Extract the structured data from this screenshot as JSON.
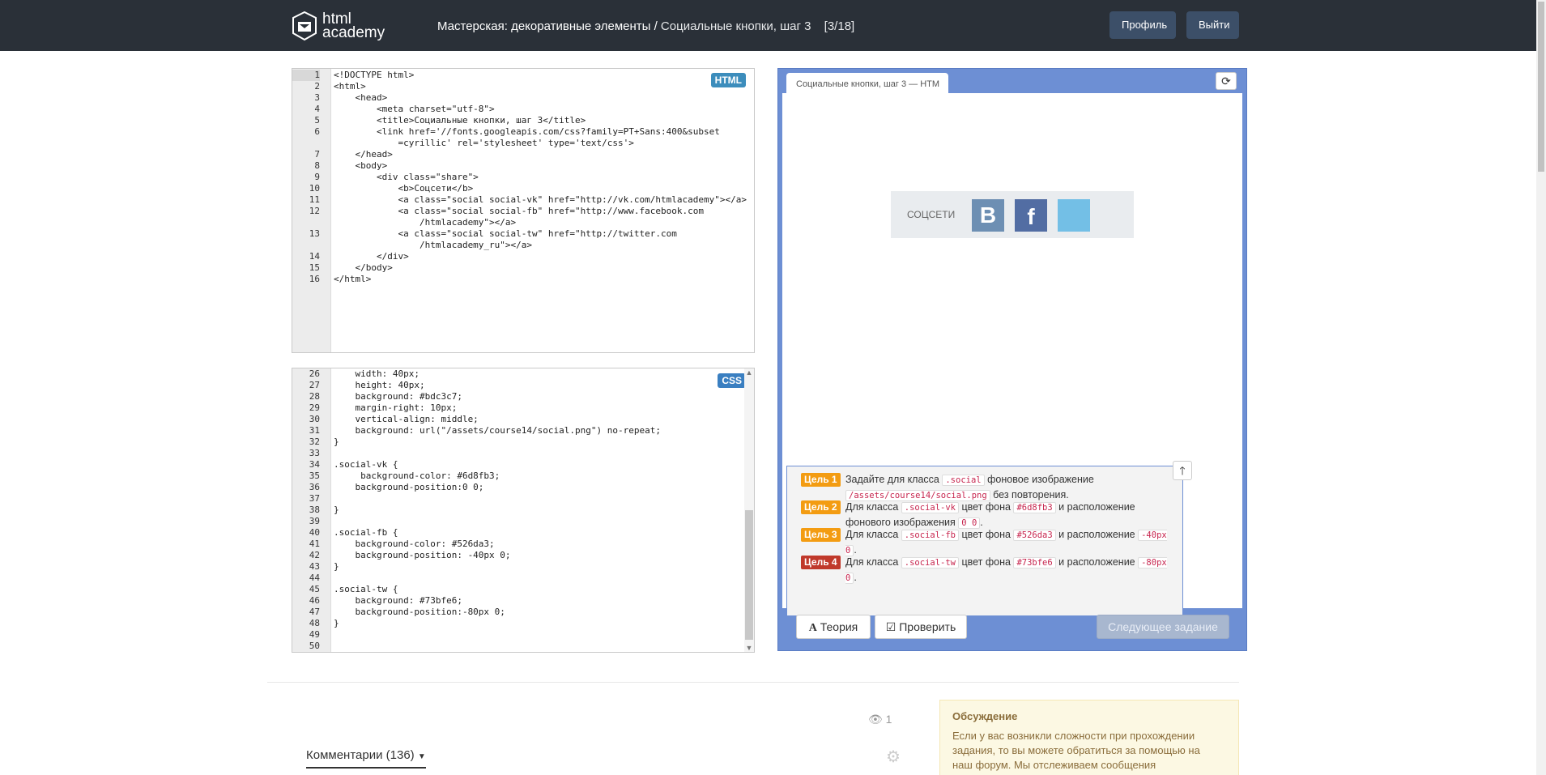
{
  "header": {
    "logo_line1": "html",
    "logo_line2": "academy",
    "crumb_bold": "Мастерская: декоративные элементы /",
    "crumb_light": "Социальные кнопки, шаг 3",
    "crumb_counter": "[3/18]",
    "profile_label": "Профиль",
    "logout_label": "Выйти"
  },
  "html_editor": {
    "badge": "HTML",
    "lines": [
      {
        "n": "1",
        "t": "<!DOCTYPE html>"
      },
      {
        "n": "2",
        "t": "<html>"
      },
      {
        "n": "3",
        "t": "    <head>"
      },
      {
        "n": "4",
        "t": "        <meta charset=\"utf-8\">"
      },
      {
        "n": "5",
        "t": "        <title>Социальные кнопки, шаг 3</title>"
      },
      {
        "n": "6",
        "t": "        <link href='//fonts.googleapis.com/css?family=PT+Sans:400&subset"
      },
      {
        "n": "",
        "t": "            =cyrillic' rel='stylesheet' type='text/css'>"
      },
      {
        "n": "7",
        "t": "    </head>"
      },
      {
        "n": "8",
        "t": "    <body>"
      },
      {
        "n": "9",
        "t": "        <div class=\"share\">"
      },
      {
        "n": "10",
        "t": "            <b>Соцсети</b>"
      },
      {
        "n": "11",
        "t": "            <a class=\"social social-vk\" href=\"http://vk.com/htmlacademy\"></a>"
      },
      {
        "n": "12",
        "t": "            <a class=\"social social-fb\" href=\"http://www.facebook.com"
      },
      {
        "n": "",
        "t": "                /htmlacademy\"></a>"
      },
      {
        "n": "13",
        "t": "            <a class=\"social social-tw\" href=\"http://twitter.com"
      },
      {
        "n": "",
        "t": "                /htmlacademy_ru\"></a>"
      },
      {
        "n": "14",
        "t": "        </div>"
      },
      {
        "n": "15",
        "t": "    </body>"
      },
      {
        "n": "16",
        "t": "</html>"
      }
    ]
  },
  "css_editor": {
    "badge": "CSS",
    "lines": [
      {
        "n": "26",
        "t": "    width: 40px;"
      },
      {
        "n": "27",
        "t": "    height: 40px;"
      },
      {
        "n": "28",
        "t": "    background: #bdc3c7;"
      },
      {
        "n": "29",
        "t": "    margin-right: 10px;"
      },
      {
        "n": "30",
        "t": "    vertical-align: middle;"
      },
      {
        "n": "31",
        "t": "    background: url(\"/assets/course14/social.png\") no-repeat;"
      },
      {
        "n": "32",
        "t": "}"
      },
      {
        "n": "33",
        "t": ""
      },
      {
        "n": "34",
        "t": ".social-vk {"
      },
      {
        "n": "35",
        "t": "     background-color: #6d8fb3;"
      },
      {
        "n": "36",
        "t": "    background-position:0 0;"
      },
      {
        "n": "37",
        "t": ""
      },
      {
        "n": "38",
        "t": "}"
      },
      {
        "n": "39",
        "t": ""
      },
      {
        "n": "40",
        "t": ".social-fb {"
      },
      {
        "n": "41",
        "t": "    background-color: #526da3;"
      },
      {
        "n": "42",
        "t": "    background-position: -40px 0;"
      },
      {
        "n": "43",
        "t": "}"
      },
      {
        "n": "44",
        "t": ""
      },
      {
        "n": "45",
        "t": ".social-tw {"
      },
      {
        "n": "46",
        "t": "    background: #73bfe6;"
      },
      {
        "n": "47",
        "t": "    background-position:-80px 0;"
      },
      {
        "n": "48",
        "t": "}"
      },
      {
        "n": "49",
        "t": ""
      },
      {
        "n": "50",
        "t": ""
      }
    ]
  },
  "preview": {
    "tab_title": "Социальные кнопки, шаг 3 — HTM",
    "share_label": "СОЦСЕТИ",
    "vk_letter": "B",
    "fb_letter": "f",
    "colors": {
      "vk": "#6d8fb3",
      "fb": "#526da3",
      "tw": "#73bfe6"
    }
  },
  "goals": [
    {
      "tag": "Цель 1",
      "color": "orange",
      "parts": [
        "Задайте для класса ",
        ".social",
        " фоновое изображение ",
        "/assets/course14/social.png",
        " без повторения."
      ]
    },
    {
      "tag": "Цель 2",
      "color": "orange",
      "parts": [
        "Для класса ",
        ".social-vk",
        " цвет фона ",
        "#6d8fb3",
        " и расположение фонового изображения ",
        "0 0",
        "."
      ]
    },
    {
      "tag": "Цель 3",
      "color": "orange",
      "parts": [
        "Для класса ",
        ".social-fb",
        " цвет фона ",
        "#526da3",
        " и расположение ",
        "-40px 0",
        "."
      ]
    },
    {
      "tag": "Цель 4",
      "color": "red",
      "parts": [
        "Для класса ",
        ".social-tw",
        " цвет фона ",
        "#73bfe6",
        " и расположение ",
        "-80px 0",
        "."
      ]
    }
  ],
  "actions": {
    "theory_label": "Теория",
    "check_label": "Проверить",
    "next_label": "Следующее задание"
  },
  "footer": {
    "views_count": "1",
    "comments_label": "Комментарии (136)",
    "forum_title": "Обсуждение",
    "forum_text": "Если у вас возникли сложности при прохождении задания, то вы можете обратиться за помощью на наш форум. Мы отслеживаем сообщения"
  }
}
